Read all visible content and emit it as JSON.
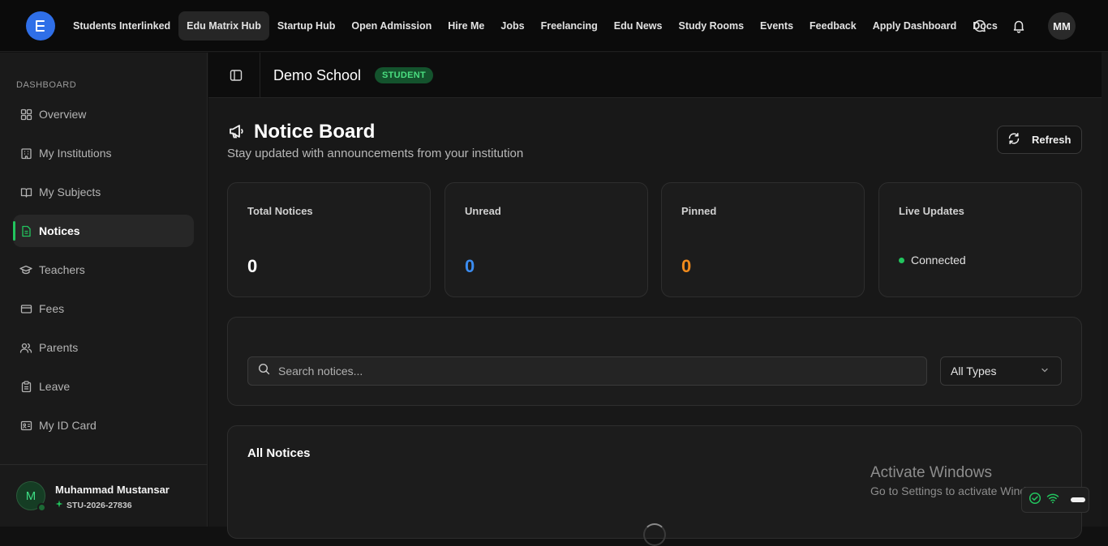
{
  "topbar": {
    "nav": [
      {
        "label": "Students Interlinked",
        "active": false
      },
      {
        "label": "Edu Matrix Hub",
        "active": true
      },
      {
        "label": "Startup Hub",
        "active": false
      },
      {
        "label": "Open Admission",
        "active": false
      },
      {
        "label": "Hire Me",
        "active": false
      },
      {
        "label": "Jobs",
        "active": false
      },
      {
        "label": "Freelancing",
        "active": false
      },
      {
        "label": "Edu News",
        "active": false
      },
      {
        "label": "Study Rooms",
        "active": false
      },
      {
        "label": "Events",
        "active": false
      },
      {
        "label": "Feedback",
        "active": false
      },
      {
        "label": "Apply Dashboard",
        "active": false
      },
      {
        "label": "Docs",
        "active": false
      }
    ],
    "avatar_initials": "MM"
  },
  "sidebar": {
    "section_title": "DASHBOARD",
    "items": [
      {
        "label": "Overview",
        "icon": "grid-icon"
      },
      {
        "label": "My Institutions",
        "icon": "building-icon"
      },
      {
        "label": "My Subjects",
        "icon": "book-icon"
      },
      {
        "label": "Notices",
        "icon": "document-icon",
        "active": true
      },
      {
        "label": "Teachers",
        "icon": "graduation-cap-icon"
      },
      {
        "label": "Fees",
        "icon": "credit-card-icon"
      },
      {
        "label": "Parents",
        "icon": "users-icon"
      },
      {
        "label": "Leave",
        "icon": "clipboard-icon"
      },
      {
        "label": "My ID Card",
        "icon": "id-card-icon"
      }
    ],
    "user": {
      "initial": "M",
      "name": "Muhammad Mustansar",
      "student_id": "STU-2026-27836"
    }
  },
  "subheader": {
    "school_name": "Demo School",
    "role_badge": "STUDENT"
  },
  "main": {
    "title": "Notice Board",
    "subtitle": "Stay updated with announcements from your institution",
    "refresh_label": "Refresh",
    "stats": [
      {
        "label": "Total Notices",
        "value": "0",
        "color": "#ffffff"
      },
      {
        "label": "Unread",
        "value": "0",
        "color": "#3b8cf0"
      },
      {
        "label": "Pinned",
        "value": "0",
        "color": "#f08a1c"
      }
    ],
    "live": {
      "label": "Live Updates",
      "status": "Connected"
    },
    "search_placeholder": "Search notices...",
    "type_filter": "All Types",
    "notices_title": "All Notices"
  },
  "os": {
    "watermark_title": "Activate Windows",
    "watermark_sub": "Go to Settings to activate Windows."
  },
  "colors": {
    "accent_green": "#22c55e",
    "brand_blue": "#2f6fe8"
  }
}
